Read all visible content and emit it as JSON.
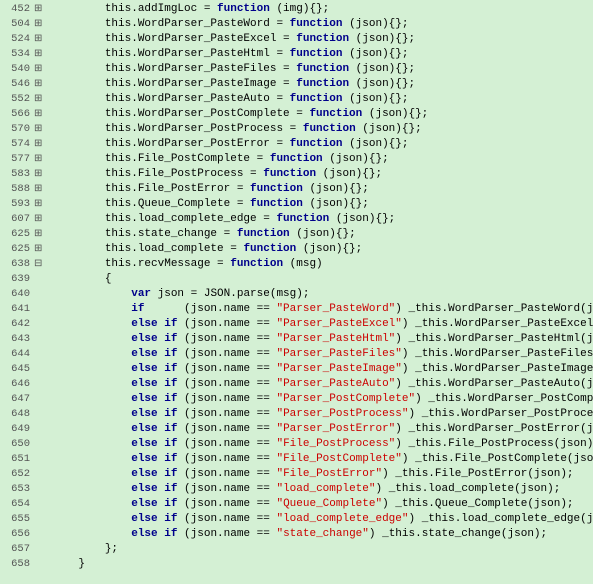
{
  "lines": [
    {
      "num": "452",
      "expand": "+",
      "indent": "        ",
      "content": [
        {
          "t": "plain",
          "v": "this.addImgLoc = "
        },
        {
          "t": "kw",
          "v": "function"
        },
        {
          "t": "plain",
          "v": " (img){};"
        }
      ]
    },
    {
      "num": "504",
      "expand": "+",
      "indent": "        ",
      "content": [
        {
          "t": "plain",
          "v": "this.WordParser_PasteWord = "
        },
        {
          "t": "kw",
          "v": "function"
        },
        {
          "t": "plain",
          "v": " (json){};"
        }
      ]
    },
    {
      "num": "524",
      "expand": "+",
      "indent": "        ",
      "content": [
        {
          "t": "plain",
          "v": "this.WordParser_PasteExcel = "
        },
        {
          "t": "kw",
          "v": "function"
        },
        {
          "t": "plain",
          "v": " (json){};"
        }
      ]
    },
    {
      "num": "534",
      "expand": "+",
      "indent": "        ",
      "content": [
        {
          "t": "plain",
          "v": "this.WordParser_PasteHtml = "
        },
        {
          "t": "kw",
          "v": "function"
        },
        {
          "t": "plain",
          "v": " (json){};"
        }
      ]
    },
    {
      "num": "540",
      "expand": "+",
      "indent": "        ",
      "content": [
        {
          "t": "plain",
          "v": "this.WordParser_PasteFiles = "
        },
        {
          "t": "kw",
          "v": "function"
        },
        {
          "t": "plain",
          "v": " (json){};"
        }
      ]
    },
    {
      "num": "546",
      "expand": "+",
      "indent": "        ",
      "content": [
        {
          "t": "plain",
          "v": "this.WordParser_PasteImage = "
        },
        {
          "t": "kw",
          "v": "function"
        },
        {
          "t": "plain",
          "v": " (json){};"
        }
      ]
    },
    {
      "num": "552",
      "expand": "+",
      "indent": "        ",
      "content": [
        {
          "t": "plain",
          "v": "this.WordParser_PasteAuto = "
        },
        {
          "t": "kw",
          "v": "function"
        },
        {
          "t": "plain",
          "v": " (json){};"
        }
      ]
    },
    {
      "num": "566",
      "expand": "+",
      "indent": "        ",
      "content": [
        {
          "t": "plain",
          "v": "this.WordParser_PostComplete = "
        },
        {
          "t": "kw",
          "v": "function"
        },
        {
          "t": "plain",
          "v": " (json){};"
        }
      ]
    },
    {
      "num": "570",
      "expand": "+",
      "indent": "        ",
      "content": [
        {
          "t": "plain",
          "v": "this.WordParser_PostProcess = "
        },
        {
          "t": "kw",
          "v": "function"
        },
        {
          "t": "plain",
          "v": " (json){};"
        }
      ]
    },
    {
      "num": "574",
      "expand": "+",
      "indent": "        ",
      "content": [
        {
          "t": "plain",
          "v": "this.WordParser_PostError = "
        },
        {
          "t": "kw",
          "v": "function"
        },
        {
          "t": "plain",
          "v": " (json){};"
        }
      ]
    },
    {
      "num": "577",
      "expand": "+",
      "indent": "        ",
      "content": [
        {
          "t": "plain",
          "v": "this.File_PostComplete = "
        },
        {
          "t": "kw",
          "v": "function"
        },
        {
          "t": "plain",
          "v": " (json){};"
        }
      ]
    },
    {
      "num": "583",
      "expand": "+",
      "indent": "        ",
      "content": [
        {
          "t": "plain",
          "v": "this.File_PostProcess = "
        },
        {
          "t": "kw",
          "v": "function"
        },
        {
          "t": "plain",
          "v": " (json){};"
        }
      ]
    },
    {
      "num": "588",
      "expand": "+",
      "indent": "        ",
      "content": [
        {
          "t": "plain",
          "v": "this.File_PostError = "
        },
        {
          "t": "kw",
          "v": "function"
        },
        {
          "t": "plain",
          "v": " (json){};"
        }
      ]
    },
    {
      "num": "593",
      "expand": "+",
      "indent": "        ",
      "content": [
        {
          "t": "plain",
          "v": "this.Queue_Complete = "
        },
        {
          "t": "kw",
          "v": "function"
        },
        {
          "t": "plain",
          "v": " (json){};"
        }
      ]
    },
    {
      "num": "607",
      "expand": "+",
      "indent": "        ",
      "content": [
        {
          "t": "plain",
          "v": "this.load_complete_edge = "
        },
        {
          "t": "kw",
          "v": "function"
        },
        {
          "t": "plain",
          "v": " (json){};"
        }
      ]
    },
    {
      "num": "625",
      "expand": "+",
      "indent": "        ",
      "content": [
        {
          "t": "plain",
          "v": "this.state_change = "
        },
        {
          "t": "kw",
          "v": "function"
        },
        {
          "t": "plain",
          "v": " (json){};"
        }
      ]
    },
    {
      "num": "625",
      "expand": "+",
      "indent": "        ",
      "content": [
        {
          "t": "plain",
          "v": "this.load_complete = "
        },
        {
          "t": "kw",
          "v": "function"
        },
        {
          "t": "plain",
          "v": " (json){};"
        }
      ]
    },
    {
      "num": "638",
      "expand": "-",
      "indent": "        ",
      "content": [
        {
          "t": "plain",
          "v": "this.recvMessage = "
        },
        {
          "t": "kw",
          "v": "function"
        },
        {
          "t": "plain",
          "v": " (msg)"
        }
      ]
    },
    {
      "num": "639",
      "expand": "",
      "indent": "        ",
      "content": [
        {
          "t": "plain",
          "v": "{"
        }
      ]
    },
    {
      "num": "640",
      "expand": "",
      "indent": "            ",
      "content": [
        {
          "t": "var-kw",
          "v": "var"
        },
        {
          "t": "plain",
          "v": " json = JSON.parse(msg);"
        }
      ]
    },
    {
      "num": "641",
      "expand": "",
      "indent": "            ",
      "content": [
        {
          "t": "kw",
          "v": "if"
        },
        {
          "t": "plain",
          "v": "      (json.name == "
        },
        {
          "t": "str",
          "v": "\"Parser_PasteWord\""
        },
        {
          "t": "plain",
          "v": ") _this.WordParser_PasteWord(json);"
        }
      ]
    },
    {
      "num": "642",
      "expand": "",
      "indent": "            ",
      "content": [
        {
          "t": "kw",
          "v": "else if"
        },
        {
          "t": "plain",
          "v": " (json.name == "
        },
        {
          "t": "str",
          "v": "\"Parser_PasteExcel\""
        },
        {
          "t": "plain",
          "v": ") _this.WordParser_PasteExcel(json);"
        }
      ]
    },
    {
      "num": "643",
      "expand": "",
      "indent": "            ",
      "content": [
        {
          "t": "kw",
          "v": "else if"
        },
        {
          "t": "plain",
          "v": " (json.name == "
        },
        {
          "t": "str",
          "v": "\"Parser_PasteHtml\""
        },
        {
          "t": "plain",
          "v": ") _this.WordParser_PasteHtml(json);"
        }
      ]
    },
    {
      "num": "644",
      "expand": "",
      "indent": "            ",
      "content": [
        {
          "t": "kw",
          "v": "else if"
        },
        {
          "t": "plain",
          "v": " (json.name == "
        },
        {
          "t": "str",
          "v": "\"Parser_PasteFiles\""
        },
        {
          "t": "plain",
          "v": ") _this.WordParser_PasteFiles(json);"
        }
      ]
    },
    {
      "num": "645",
      "expand": "",
      "indent": "            ",
      "content": [
        {
          "t": "kw",
          "v": "else if"
        },
        {
          "t": "plain",
          "v": " (json.name == "
        },
        {
          "t": "str",
          "v": "\"Parser_PasteImage\""
        },
        {
          "t": "plain",
          "v": ") _this.WordParser_PasteImage(json);"
        }
      ]
    },
    {
      "num": "646",
      "expand": "",
      "indent": "            ",
      "content": [
        {
          "t": "kw",
          "v": "else if"
        },
        {
          "t": "plain",
          "v": " (json.name == "
        },
        {
          "t": "str",
          "v": "\"Parser_PasteAuto\""
        },
        {
          "t": "plain",
          "v": ") _this.WordParser_PasteAuto(json);"
        }
      ]
    },
    {
      "num": "647",
      "expand": "",
      "indent": "            ",
      "content": [
        {
          "t": "kw",
          "v": "else if"
        },
        {
          "t": "plain",
          "v": " (json.name == "
        },
        {
          "t": "str",
          "v": "\"Parser_PostComplete\""
        },
        {
          "t": "plain",
          "v": ") _this.WordParser_PostComplete(json);"
        }
      ]
    },
    {
      "num": "648",
      "expand": "",
      "indent": "            ",
      "content": [
        {
          "t": "kw",
          "v": "else if"
        },
        {
          "t": "plain",
          "v": " (json.name == "
        },
        {
          "t": "str",
          "v": "\"Parser_PostProcess\""
        },
        {
          "t": "plain",
          "v": ") _this.WordParser_PostProcess(json);"
        }
      ]
    },
    {
      "num": "649",
      "expand": "",
      "indent": "            ",
      "content": [
        {
          "t": "kw",
          "v": "else if"
        },
        {
          "t": "plain",
          "v": " (json.name == "
        },
        {
          "t": "str",
          "v": "\"Parser_PostError\""
        },
        {
          "t": "plain",
          "v": ") _this.WordParser_PostError(json);"
        }
      ]
    },
    {
      "num": "650",
      "expand": "",
      "indent": "            ",
      "content": [
        {
          "t": "kw",
          "v": "else if"
        },
        {
          "t": "plain",
          "v": " (json.name == "
        },
        {
          "t": "str",
          "v": "\"File_PostProcess\""
        },
        {
          "t": "plain",
          "v": ") _this.File_PostProcess(json);"
        }
      ]
    },
    {
      "num": "651",
      "expand": "",
      "indent": "            ",
      "content": [
        {
          "t": "kw",
          "v": "else if"
        },
        {
          "t": "plain",
          "v": " (json.name == "
        },
        {
          "t": "str",
          "v": "\"File_PostComplete\""
        },
        {
          "t": "plain",
          "v": ") _this.File_PostComplete(json);"
        }
      ]
    },
    {
      "num": "652",
      "expand": "",
      "indent": "            ",
      "content": [
        {
          "t": "kw",
          "v": "else if"
        },
        {
          "t": "plain",
          "v": " (json.name == "
        },
        {
          "t": "str",
          "v": "\"File_PostError\""
        },
        {
          "t": "plain",
          "v": ") _this.File_PostError(json);"
        }
      ]
    },
    {
      "num": "653",
      "expand": "",
      "indent": "            ",
      "content": [
        {
          "t": "kw",
          "v": "else if"
        },
        {
          "t": "plain",
          "v": " (json.name == "
        },
        {
          "t": "str",
          "v": "\"load_complete\""
        },
        {
          "t": "plain",
          "v": ") _this.load_complete(json);"
        }
      ]
    },
    {
      "num": "654",
      "expand": "",
      "indent": "            ",
      "content": [
        {
          "t": "kw",
          "v": "else if"
        },
        {
          "t": "plain",
          "v": " (json.name == "
        },
        {
          "t": "str",
          "v": "\"Queue_Complete\""
        },
        {
          "t": "plain",
          "v": ") _this.Queue_Complete(json);"
        }
      ]
    },
    {
      "num": "655",
      "expand": "",
      "indent": "            ",
      "content": [
        {
          "t": "kw",
          "v": "else if"
        },
        {
          "t": "plain",
          "v": " (json.name == "
        },
        {
          "t": "str",
          "v": "\"load_complete_edge\""
        },
        {
          "t": "plain",
          "v": ") _this.load_complete_edge(json);"
        }
      ]
    },
    {
      "num": "656",
      "expand": "",
      "indent": "            ",
      "content": [
        {
          "t": "kw",
          "v": "else if"
        },
        {
          "t": "plain",
          "v": " (json.name == "
        },
        {
          "t": "str",
          "v": "\"state_change\""
        },
        {
          "t": "plain",
          "v": ") _this.state_change(json);"
        }
      ]
    },
    {
      "num": "657",
      "expand": "",
      "indent": "        ",
      "content": [
        {
          "t": "plain",
          "v": "};"
        }
      ]
    },
    {
      "num": "658",
      "expand": "",
      "indent": "    ",
      "content": [
        {
          "t": "plain",
          "v": "}"
        }
      ]
    }
  ]
}
